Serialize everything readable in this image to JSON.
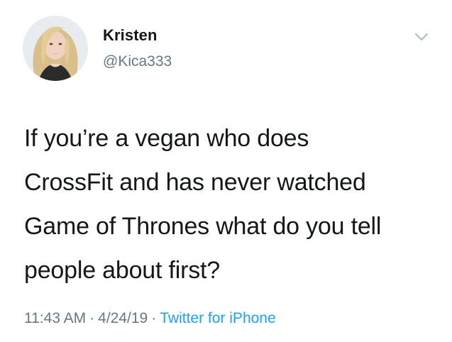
{
  "author": {
    "display_name": "Kristen",
    "handle": "@Kica333"
  },
  "icons": {
    "avatar": "profile-photo",
    "menu": "chevron-down-icon"
  },
  "tweet": {
    "lines": [
      "If you’re a vegan who does",
      "CrossFit and has never watched",
      "Game of Thrones what do you tell",
      "people about first?"
    ]
  },
  "meta": {
    "time": "11:43 AM",
    "separator": "·",
    "date": "4/24/19",
    "source": "Twitter for iPhone"
  },
  "colors": {
    "text": "#14171a",
    "secondary": "#657786",
    "link": "#1da1f2"
  }
}
